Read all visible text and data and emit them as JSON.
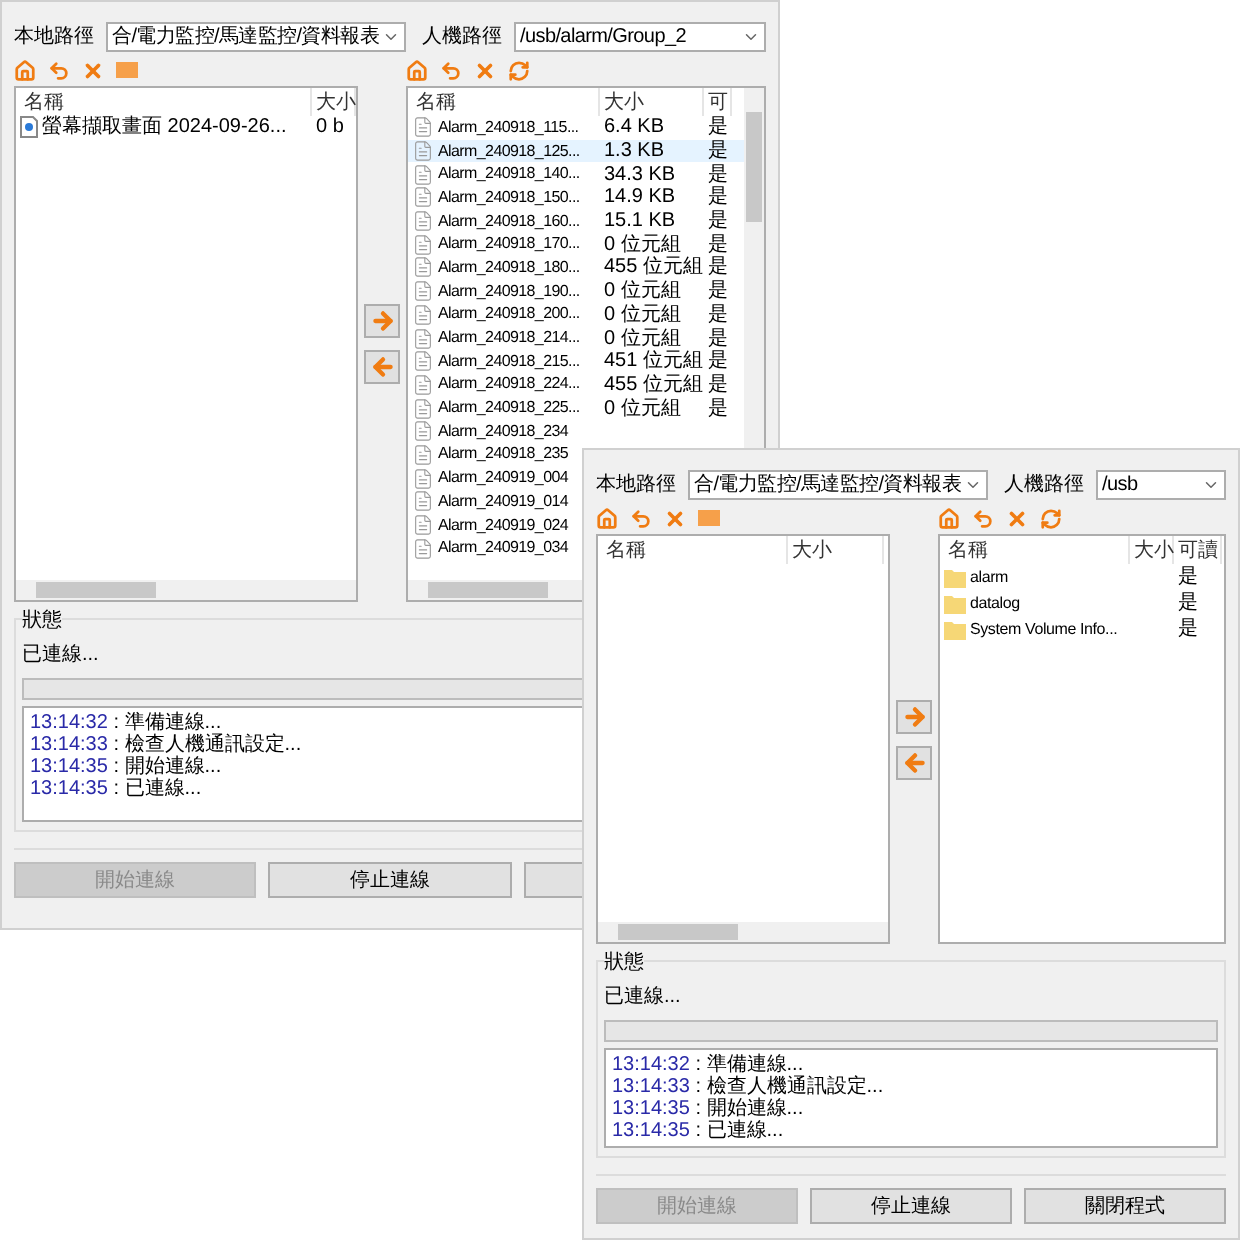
{
  "windows": [
    {
      "local_path": {
        "label": "本地路徑",
        "value": "合/電力監控/馬達監控/資料報表"
      },
      "remote_path": {
        "label": "人機路徑",
        "value": "/usb/alarm/Group_2"
      },
      "local_list": {
        "columns": [
          "名稱",
          "大小"
        ],
        "rows": [
          {
            "kind": "image",
            "name": "螢幕擷取畫面 2024-09-26...",
            "size": "0 b",
            "selected": false
          }
        ]
      },
      "remote_list": {
        "columns": [
          "名稱",
          "大小",
          "可"
        ],
        "rows": [
          {
            "kind": "file",
            "name": "Alarm_240918_115...",
            "size": "6.4 KB",
            "readable": "是",
            "selected": false
          },
          {
            "kind": "file",
            "name": "Alarm_240918_125...",
            "size": "1.3 KB",
            "readable": "是",
            "selected": true
          },
          {
            "kind": "file",
            "name": "Alarm_240918_140...",
            "size": "34.3 KB",
            "readable": "是",
            "selected": false
          },
          {
            "kind": "file",
            "name": "Alarm_240918_150...",
            "size": "14.9 KB",
            "readable": "是",
            "selected": false
          },
          {
            "kind": "file",
            "name": "Alarm_240918_160...",
            "size": "15.1 KB",
            "readable": "是",
            "selected": false
          },
          {
            "kind": "file",
            "name": "Alarm_240918_170...",
            "size": "0 位元組",
            "readable": "是",
            "selected": false
          },
          {
            "kind": "file",
            "name": "Alarm_240918_180...",
            "size": "455 位元組",
            "readable": "是",
            "selected": false
          },
          {
            "kind": "file",
            "name": "Alarm_240918_190...",
            "size": "0 位元組",
            "readable": "是",
            "selected": false
          },
          {
            "kind": "file",
            "name": "Alarm_240918_200...",
            "size": "0 位元組",
            "readable": "是",
            "selected": false
          },
          {
            "kind": "file",
            "name": "Alarm_240918_214...",
            "size": "0 位元組",
            "readable": "是",
            "selected": false
          },
          {
            "kind": "file",
            "name": "Alarm_240918_215...",
            "size": "451 位元組",
            "readable": "是",
            "selected": false
          },
          {
            "kind": "file",
            "name": "Alarm_240918_224...",
            "size": "455 位元組",
            "readable": "是",
            "selected": false
          },
          {
            "kind": "file",
            "name": "Alarm_240918_225...",
            "size": "0 位元組",
            "readable": "是",
            "selected": false
          },
          {
            "kind": "file",
            "name": "Alarm_240918_234",
            "selected": false
          },
          {
            "kind": "file",
            "name": "Alarm_240918_235",
            "selected": false
          },
          {
            "kind": "file",
            "name": "Alarm_240919_004",
            "selected": false
          },
          {
            "kind": "file",
            "name": "Alarm_240919_014",
            "selected": false
          },
          {
            "kind": "file",
            "name": "Alarm_240919_024",
            "selected": false
          },
          {
            "kind": "file",
            "name": "Alarm_240919_034",
            "selected": false
          }
        ]
      },
      "status": {
        "title": "狀態",
        "message": "已連線...",
        "level": 0,
        "log": [
          {
            "time": "13:14:32",
            "text": " : 準備連線..."
          },
          {
            "time": "13:14:33",
            "text": " : 檢查人機通訊設定..."
          },
          {
            "time": "13:14:35",
            "text": " : 開始連線..."
          },
          {
            "time": "13:14:35",
            "text": " : 已連線..."
          }
        ]
      },
      "buttons": [
        {
          "label": "開始連線",
          "disabled": true
        },
        {
          "label": "停止連線",
          "disabled": false
        },
        {
          "disabled": false
        }
      ]
    },
    {
      "local_path": {
        "label": "本地路徑",
        "value": "合/電力監控/馬達監控/資料報表"
      },
      "remote_path": {
        "label": "人機路徑",
        "value": "/usb"
      },
      "local_list": {
        "columns": [
          "名稱",
          "大小"
        ]
      },
      "remote_list": {
        "columns": [
          "名稱",
          "大小",
          "可讀"
        ],
        "rows": [
          {
            "kind": "folder",
            "name": "alarm",
            "readable": "是",
            "selected": false
          },
          {
            "kind": "folder",
            "name": "datalog",
            "readable": "是",
            "selected": false
          },
          {
            "kind": "folder",
            "name": "System Volume Info...",
            "readable": "是",
            "selected": false
          }
        ]
      },
      "status": {
        "title": "狀態",
        "message": "已連線...",
        "level": 0,
        "log": [
          {
            "time": "13:14:32",
            "text": " : 準備連線..."
          },
          {
            "time": "13:14:33",
            "text": " : 檢查人機通訊設定..."
          },
          {
            "time": "13:14:35",
            "text": " : 開始連線..."
          },
          {
            "time": "13:14:35",
            "text": " : 已連線..."
          }
        ]
      },
      "buttons": [
        {
          "label": "開始連線",
          "disabled": true
        },
        {
          "label": "停止連線",
          "disabled": false
        },
        {
          "label": "關閉程式",
          "disabled": false
        }
      ]
    }
  ]
}
